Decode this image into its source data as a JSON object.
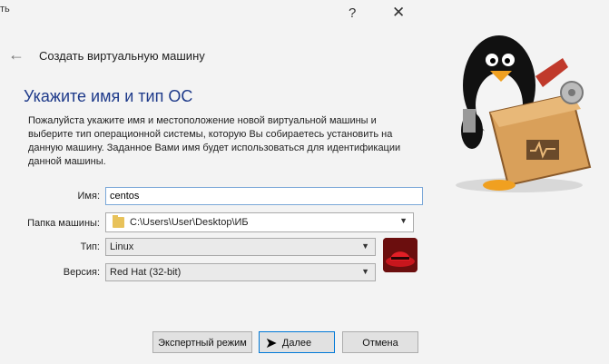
{
  "titlebar": {
    "help_label": "?",
    "close_label": "✕",
    "extra_label": "ть"
  },
  "wizard": {
    "back_icon": "arrow-left-icon",
    "title": "Создать виртуальную машину"
  },
  "page": {
    "heading": "Укажите имя и тип ОС",
    "description": "Пожалуйста укажите имя и местоположение новой виртуальной машины и выберите тип операционной системы, которую Вы собираетесь установить на данную машину. Заданное Вами имя будет использоваться для идентификации данной машины."
  },
  "form": {
    "name_label": "Имя:",
    "name_value": "centos",
    "folder_label": "Папка машины:",
    "folder_value": "C:\\Users\\User\\Desktop\\ИБ",
    "type_label": "Тип:",
    "type_value": "Linux",
    "version_label": "Версия:",
    "version_value": "Red Hat (32-bit)"
  },
  "buttons": {
    "expert": "Экспертный режим",
    "next": "Далее",
    "cancel": "Отмена"
  },
  "colors": {
    "heading": "#1e3a8a",
    "accent": "#0078d7"
  }
}
